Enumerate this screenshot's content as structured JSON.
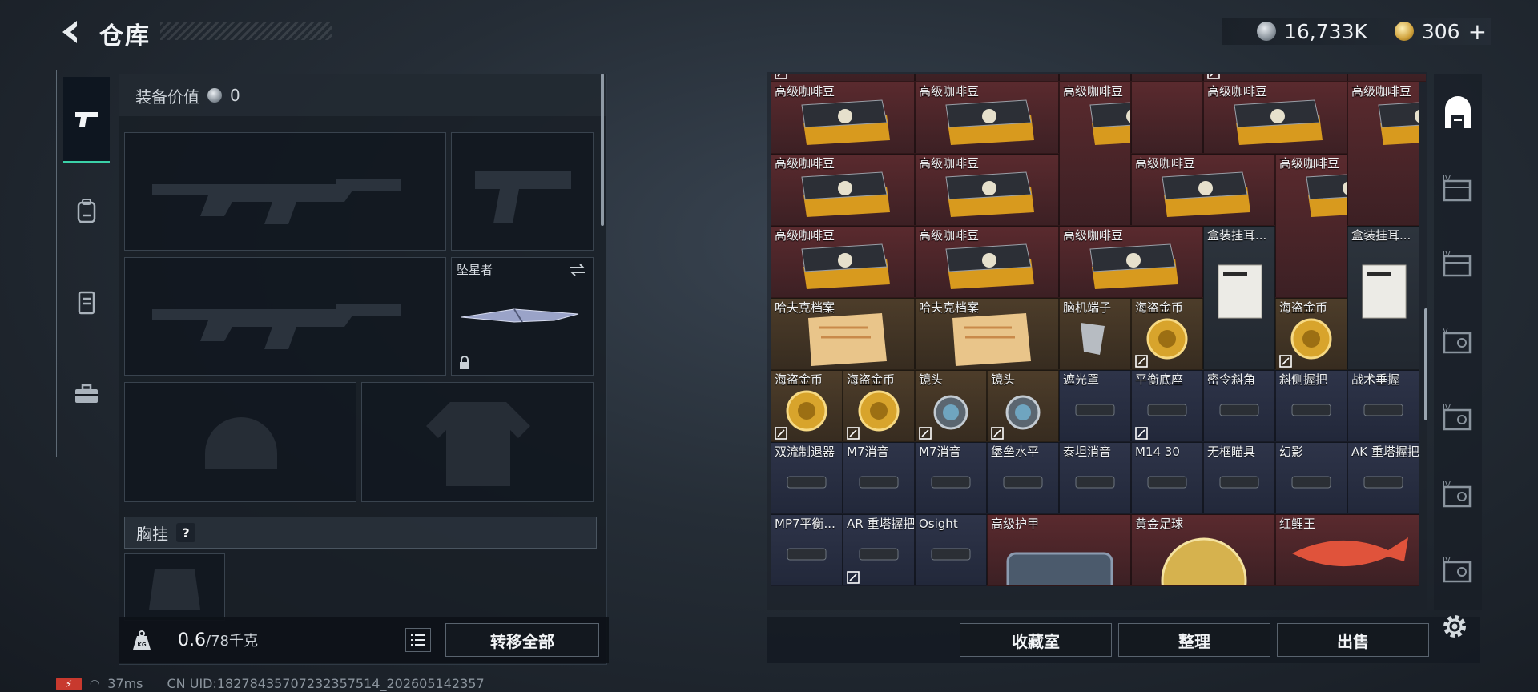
{
  "header": {
    "title": "仓库",
    "silver_amount": "16,733K",
    "gold_amount": "306",
    "add_symbol": "+"
  },
  "left_tabs": [
    {
      "icon": "pistol-icon",
      "active": true
    },
    {
      "icon": "backpack-icon",
      "active": false
    },
    {
      "icon": "vest-icon",
      "active": false
    },
    {
      "icon": "toolbox-icon",
      "active": false
    }
  ],
  "loadout": {
    "value_label": "装备价值",
    "value_amount": "0",
    "melee_name": "坠星者",
    "chest_label": "胸挂",
    "help_symbol": "?",
    "weight_current": "0.6",
    "weight_max": "/78千克",
    "transfer_all_label": "转移全部"
  },
  "inventory_items": [
    {
      "name": "",
      "color": "red",
      "linked": true
    },
    {
      "name": "",
      "color": "red",
      "linked": false
    },
    {
      "name": "",
      "color": "red",
      "linked": false
    },
    {
      "name": "",
      "color": "red",
      "linked": false
    },
    {
      "name": "",
      "color": "red",
      "linked": true
    },
    {
      "name": "",
      "color": "red",
      "linked": false
    },
    {
      "name": "高级咖啡豆",
      "color": "red",
      "linked": false
    },
    {
      "name": "高级咖啡豆",
      "color": "red",
      "linked": false
    },
    {
      "name": "高级咖啡豆",
      "color": "red",
      "linked": false
    },
    {
      "name": "",
      "color": "red",
      "linked": false
    },
    {
      "name": "高级咖啡豆",
      "color": "red",
      "linked": false
    },
    {
      "name": "高级咖啡豆",
      "color": "red",
      "linked": false
    },
    {
      "name": "高级咖啡豆",
      "color": "red",
      "linked": false
    },
    {
      "name": "高级咖啡豆",
      "color": "red",
      "linked": false
    },
    {
      "name": "高级咖啡豆",
      "color": "red",
      "linked": false
    },
    {
      "name": "高级咖啡豆",
      "color": "red",
      "linked": false
    },
    {
      "name": "高级咖啡豆",
      "color": "red",
      "linked": false
    },
    {
      "name": "高级咖啡豆",
      "color": "red",
      "linked": false
    },
    {
      "name": "高级咖啡豆",
      "color": "red",
      "linked": false
    },
    {
      "name": "盒装挂耳...",
      "color": "gray",
      "linked": false
    },
    {
      "name": "盒装挂耳...",
      "color": "gray",
      "linked": false
    },
    {
      "name": "哈夫克档案",
      "color": "brown",
      "linked": false
    },
    {
      "name": "哈夫克档案",
      "color": "brown",
      "linked": false
    },
    {
      "name": "脑机端子",
      "color": "brown",
      "linked": false
    },
    {
      "name": "海盗金币",
      "color": "brown",
      "linked": true
    },
    {
      "name": "海盗金币",
      "color": "brown",
      "linked": true
    },
    {
      "name": "海盗金币",
      "color": "brown",
      "linked": true
    },
    {
      "name": "海盗金币",
      "color": "brown",
      "linked": true
    },
    {
      "name": "镜头",
      "color": "brown",
      "linked": true
    },
    {
      "name": "镜头",
      "color": "brown",
      "linked": true
    },
    {
      "name": "遮光罩",
      "color": "blue",
      "linked": false
    },
    {
      "name": "平衡底座",
      "color": "blue",
      "linked": true
    },
    {
      "name": "密令斜角",
      "color": "blue",
      "linked": false
    },
    {
      "name": "斜侧握把",
      "color": "blue",
      "linked": false
    },
    {
      "name": "战术垂握",
      "color": "blue",
      "linked": false
    },
    {
      "name": "双流制退器",
      "color": "blue",
      "linked": false
    },
    {
      "name": "M7消音",
      "color": "blue",
      "linked": false
    },
    {
      "name": "M7消音",
      "color": "blue",
      "linked": false
    },
    {
      "name": "堡垒水平",
      "color": "blue",
      "linked": false
    },
    {
      "name": "泰坦消音",
      "color": "blue",
      "linked": false
    },
    {
      "name": "M14 30",
      "color": "blue",
      "linked": false
    },
    {
      "name": "无框瞄具",
      "color": "blue",
      "linked": false
    },
    {
      "name": "幻影",
      "color": "blue",
      "linked": false
    },
    {
      "name": "AK 重塔握把",
      "color": "blue",
      "linked": false
    },
    {
      "name": "MP7平衡...",
      "color": "blue",
      "linked": false
    },
    {
      "name": "AR 重塔握把",
      "color": "blue",
      "linked": true
    },
    {
      "name": "Osight",
      "color": "blue",
      "linked": false
    },
    {
      "name": "高级护甲",
      "color": "red",
      "linked": false
    },
    {
      "name": "黄金足球",
      "color": "red",
      "linked": false
    },
    {
      "name": "红鲤王",
      "color": "red",
      "linked": false
    }
  ],
  "bottom_actions": {
    "collection_label": "收藏室",
    "sort_label": "整理",
    "sell_label": "出售"
  },
  "status": {
    "ping": "37ms",
    "uid": "CN UID:18278435707232357514_202605142357"
  },
  "colors": {
    "accent": "#3bd1a8",
    "rarity_red": "#5a2a2e",
    "rarity_blue": "#2e3449",
    "rarity_brown": "#4d3d2a"
  }
}
